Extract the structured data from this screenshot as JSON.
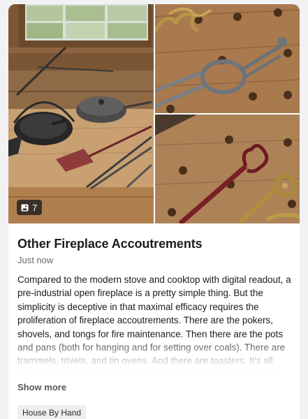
{
  "post": {
    "title": "Other Fireplace Accoutrements",
    "timestamp": "Just now",
    "description": "Compared to the modern stove and cooktop with digital readout, a pre-industrial open fireplace is a pretty simple thing. But the simplicity is deceptive in that maximal efficacy requires the proliferation of fireplace accoutrements. There are the pokers, shovels, and tongs for fire maintenance. Then there are the pots and pans (both for hanging and for setting over coals). There are trammels, trivets, and tin ovens. And there are toasters. It’s all quite overwhelming if you try to take it in all at once. Fortunately, Julia has",
    "show_more_label": "Show more",
    "tag": "House By Hand"
  },
  "gallery": {
    "photo_count": "7",
    "count_icon": "image-icon",
    "photos": [
      {
        "name": "fireplace-tools-on-bench"
      },
      {
        "name": "wrought-iron-hook-on-workbench"
      },
      {
        "name": "red-handled-poker-with-heart-hook"
      }
    ]
  },
  "colors": {
    "card_background": "#ffffff",
    "page_background": "#f2f2f4",
    "title_text": "#1c1c1e",
    "muted_text": "#6b6b70",
    "tag_background": "#eeeef0"
  }
}
